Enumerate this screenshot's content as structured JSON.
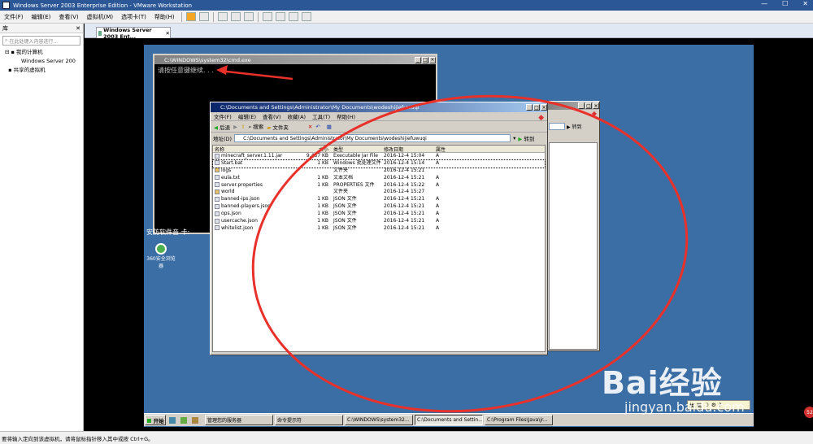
{
  "host": {
    "title": "Windows Server 2003 Enterprise Edition - VMware Workstation",
    "menu": [
      "文件(F)",
      "编辑(E)",
      "查看(V)",
      "虚拟机(M)",
      "选项卡(T)",
      "帮助(H)"
    ],
    "library": {
      "header": "库",
      "search_placeholder": "在此处键入内容进行...",
      "tree": [
        {
          "label": "我的计算机",
          "level": 0
        },
        {
          "label": "Windows Server 200",
          "level": 1
        },
        {
          "label": "共享的虚拟机",
          "level": 0
        }
      ]
    },
    "tab_label": "Windows Server 2003 Ent...",
    "status_text": "要将输入定向到该虚拟机，请将鼠标指针移入其中或按 Ctrl+G。"
  },
  "guest": {
    "desktop_icons": [
      {
        "label": "360安全浏览器"
      }
    ],
    "cmd": {
      "title": "C:\\WINDOWS\\system32\\cmd.exe",
      "text": "请按任意键继续. . .",
      "partial_text": "安防软件音  卡:"
    },
    "explorer": {
      "title": "C:\\Documents and Settings\\Administrator\\My Documents\\wodeshijiefuwuqi",
      "menu": [
        "文件(F)",
        "编辑(E)",
        "查看(V)",
        "收藏(A)",
        "工具(T)",
        "帮助(H)"
      ],
      "toolbar": {
        "back": "后退",
        "search": "搜索",
        "folders": "文件夹"
      },
      "address_label": "地址(D)",
      "address": "C:\\Documents and Settings\\Administrator\\My Documents\\wodeshijiefuwuqi",
      "go": "转到",
      "columns": [
        "名称",
        "大小",
        "类型",
        "修改日期",
        "属性"
      ],
      "files": [
        {
          "name": "minecraft_server.1.11.jar",
          "size": "9,487 KB",
          "type": "Executable Jar File",
          "date": "2016-12-4 15:04",
          "attr": "A"
        },
        {
          "name": "Start.bat",
          "size": "1 KB",
          "type": "Windows 批处理文件",
          "date": "2016-12-4 15:14",
          "attr": "A"
        },
        {
          "name": "logs",
          "size": "",
          "type": "文件夹",
          "date": "2016-12-4 15:21",
          "attr": ""
        },
        {
          "name": "eula.txt",
          "size": "1 KB",
          "type": "文本文档",
          "date": "2016-12-4 15:21",
          "attr": "A"
        },
        {
          "name": "server.properties",
          "size": "1 KB",
          "type": "PROPERTIES 文件",
          "date": "2016-12-4 15:22",
          "attr": "A"
        },
        {
          "name": "world",
          "size": "",
          "type": "文件夹",
          "date": "2016-12-4 15:27",
          "attr": ""
        },
        {
          "name": "banned-ips.json",
          "size": "1 KB",
          "type": "JSON 文件",
          "date": "2016-12-4 15:21",
          "attr": "A"
        },
        {
          "name": "banned-players.json",
          "size": "1 KB",
          "type": "JSON 文件",
          "date": "2016-12-4 15:21",
          "attr": "A"
        },
        {
          "name": "ops.json",
          "size": "1 KB",
          "type": "JSON 文件",
          "date": "2016-12-4 15:21",
          "attr": "A"
        },
        {
          "name": "usercache.json",
          "size": "1 KB",
          "type": "JSON 文件",
          "date": "2016-12-4 15:21",
          "attr": "A"
        },
        {
          "name": "whitelist.json",
          "size": "1 KB",
          "type": "JSON 文件",
          "date": "2016-12-4 15:21",
          "attr": "A"
        }
      ]
    },
    "behind_explorer": {
      "go": "转到"
    },
    "taskbar": {
      "start": "开始",
      "tasks": [
        {
          "label": "管理您的服务器"
        },
        {
          "label": "命令提示符"
        },
        {
          "label": "C:\\WINDOWS\\system32..."
        },
        {
          "label": "C:\\Documents and Settin..."
        },
        {
          "label": "C:\\Program Files\\Java\\jr..."
        }
      ]
    },
    "ime": "拼 英"
  },
  "watermark": {
    "logo": "Bai经验",
    "url": "jingyan.baidu.com"
  },
  "notification_count": "52",
  "colors": {
    "desktop": "#3a6ea5",
    "annotation": "#e8312a",
    "titlebar": "#0a246a"
  }
}
